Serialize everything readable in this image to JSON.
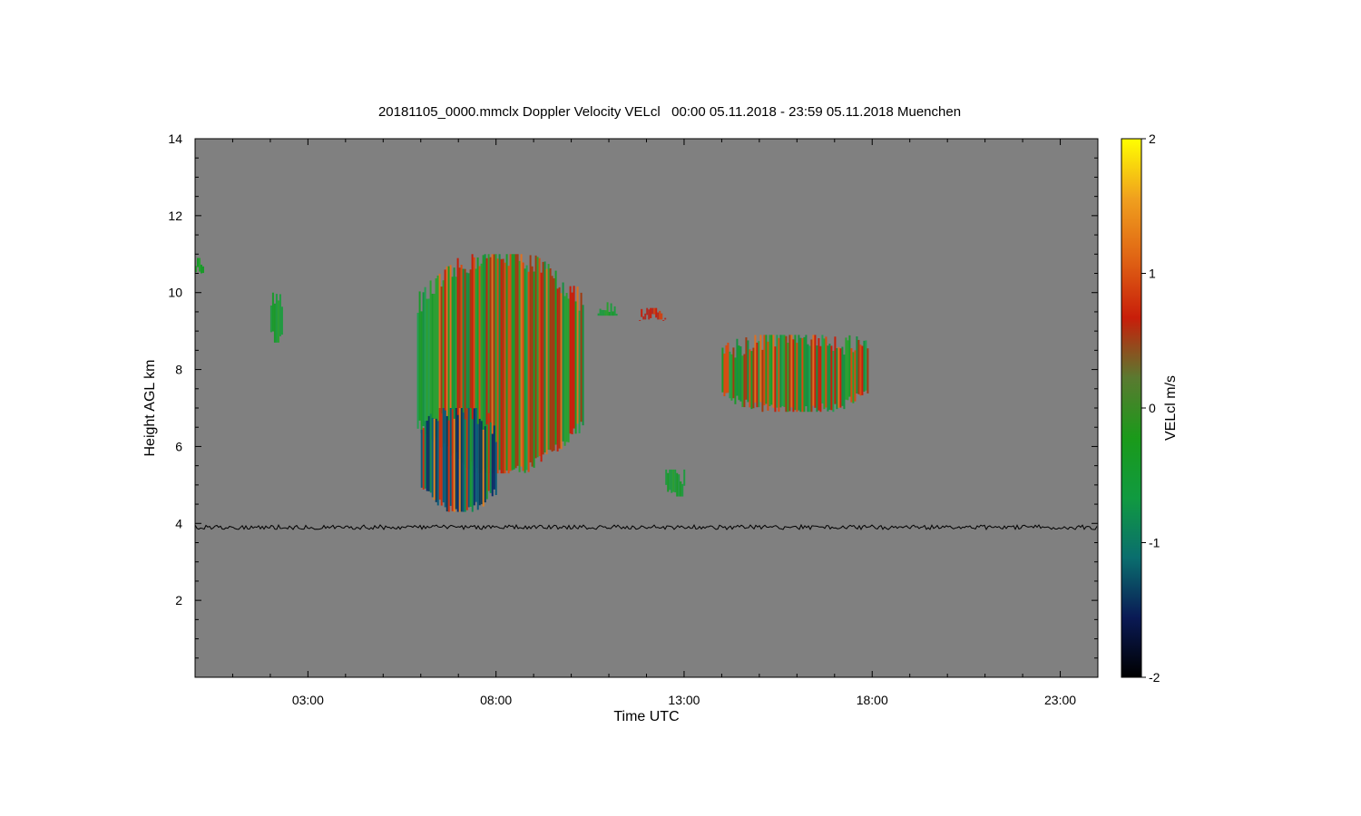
{
  "chart_data": {
    "type": "heatmap",
    "title": "20181105_0000.mmclx Doppler Velocity VELcl   00:00 05.11.2018 - 23:59 05.11.2018 Muenchen",
    "xlabel": "Time UTC",
    "ylabel": "Height AGL km",
    "x_tick_labels": [
      "03:00",
      "08:00",
      "13:00",
      "18:00",
      "23:00"
    ],
    "x_ticks_hours": [
      3,
      8,
      13,
      18,
      23
    ],
    "xlim_hours": [
      0,
      24
    ],
    "y_ticks": [
      "2",
      "4",
      "6",
      "8",
      "10",
      "12",
      "14"
    ],
    "ylim_km": [
      0,
      14
    ],
    "background_color": "#808080",
    "colorbar": {
      "label": "VELcl m/s",
      "range": [
        -2,
        2
      ],
      "tick_labels": [
        "-2",
        "-1",
        "0",
        "1",
        "2"
      ],
      "colors": [
        "#000000",
        "#0a1a55",
        "#0a6e6e",
        "#109a40",
        "#1a9a1a",
        "#5a7a30",
        "#c81e0a",
        "#e06414",
        "#f0a01e",
        "#ffff00"
      ]
    },
    "echo_regions": [
      {
        "t0": 5.9,
        "t1": 10.3,
        "h0": 5.3,
        "h1": 11.0,
        "dominant": "green/red"
      },
      {
        "t0": 6.0,
        "t1": 8.0,
        "h0": 4.3,
        "h1": 7.0,
        "dominant": "blue/green"
      },
      {
        "t0": 14.0,
        "t1": 17.9,
        "h0": 6.9,
        "h1": 8.9,
        "dominant": "green/red"
      },
      {
        "t0": 12.5,
        "t1": 13.0,
        "h0": 4.7,
        "h1": 5.4,
        "dominant": "green"
      },
      {
        "t0": 10.7,
        "t1": 11.2,
        "h0": 9.4,
        "h1": 9.8,
        "dominant": "green"
      },
      {
        "t0": 11.8,
        "t1": 12.5,
        "h0": 9.3,
        "h1": 9.6,
        "dominant": "red"
      },
      {
        "t0": 2.0,
        "t1": 2.3,
        "h0": 8.7,
        "h1": 10.0,
        "dominant": "green"
      },
      {
        "t0": 0.0,
        "t1": 0.2,
        "h0": 10.5,
        "h1": 10.9,
        "dominant": "green"
      }
    ],
    "noise_line_km": 3.9
  }
}
